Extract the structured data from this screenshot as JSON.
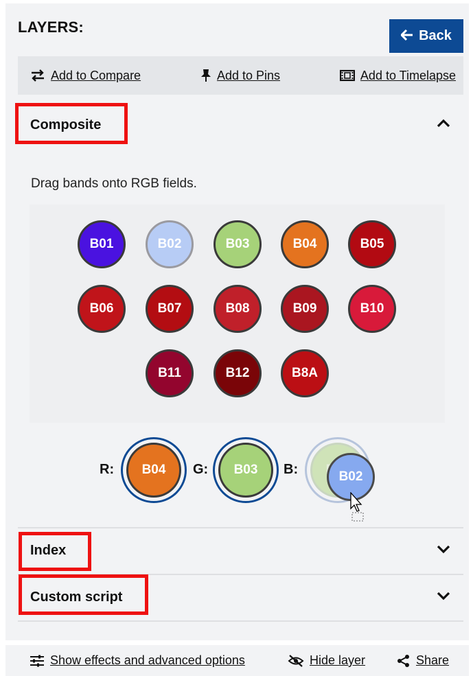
{
  "header": {
    "title": "LAYERS:",
    "back_label": "Back"
  },
  "actions": [
    {
      "label": "Add to Compare",
      "icon": "compare-arrows-icon"
    },
    {
      "label": "Add to Pins",
      "icon": "pin-icon"
    },
    {
      "label": "Add to Timelapse",
      "icon": "film-icon"
    }
  ],
  "sections": {
    "composite": {
      "title": "Composite",
      "expanded": true
    },
    "index": {
      "title": "Index",
      "expanded": false
    },
    "custom_script": {
      "title": "Custom script",
      "expanded": false
    }
  },
  "composite": {
    "hint": "Drag bands onto RGB fields.",
    "bands": [
      {
        "label": "B01",
        "color": "#4a12e0"
      },
      {
        "label": "B02",
        "color": "#b7ccf5"
      },
      {
        "label": "B03",
        "color": "#a6d279"
      },
      {
        "label": "B04",
        "color": "#e4731f"
      },
      {
        "label": "B05",
        "color": "#b20a12"
      },
      {
        "label": "B06",
        "color": "#c0141a"
      },
      {
        "label": "B07",
        "color": "#b30d12"
      },
      {
        "label": "B08",
        "color": "#c0202a"
      },
      {
        "label": "B09",
        "color": "#aa1620"
      },
      {
        "label": "B10",
        "color": "#d81a3a"
      },
      {
        "label": "B11",
        "color": "#93052e"
      },
      {
        "label": "B12",
        "color": "#7a0508"
      },
      {
        "label": "B8A",
        "color": "#bb0f14"
      }
    ],
    "rgb": {
      "r_label": "R:",
      "r_band": "B04",
      "r_color": "#e4731f",
      "g_label": "G:",
      "g_band": "B03",
      "g_color": "#a6d279",
      "b_label": "B:",
      "b_band": "B03",
      "b_color": "#cfe3b8"
    },
    "dragging": {
      "label": "B02",
      "color": "#86a9ef"
    }
  },
  "footer": [
    {
      "label": "Show effects and advanced options",
      "icon": "sliders-icon"
    },
    {
      "label": "Hide layer",
      "icon": "eye-off-icon"
    },
    {
      "label": "Share",
      "icon": "share-icon"
    }
  ]
}
